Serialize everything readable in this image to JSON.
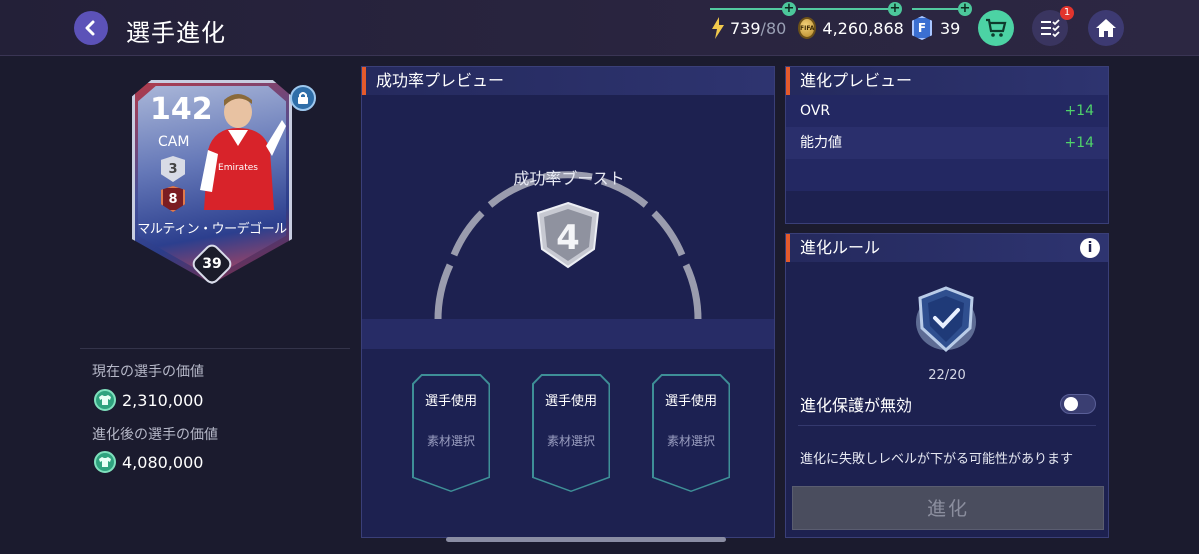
{
  "header": {
    "title": "選手進化",
    "energy": {
      "current": "739",
      "max": "/80"
    },
    "coins": "4,260,868",
    "fc_points": "39",
    "notification_count": "1"
  },
  "player_card": {
    "ovr": "142",
    "position": "CAM",
    "rank": "3",
    "level": "8",
    "name": "マルティン・ウーデゴール",
    "number": "39"
  },
  "values": {
    "current_label": "現在の選手の価値",
    "current_value": "2,310,000",
    "after_label": "進化後の選手の価値",
    "after_value": "4,080,000"
  },
  "success_panel": {
    "header": "成功率プレビュー",
    "boost_title": "成功率ブースト",
    "boost_level": "4",
    "slots": [
      {
        "title": "選手使用",
        "sub": "素材選択"
      },
      {
        "title": "選手使用",
        "sub": "素材選択"
      },
      {
        "title": "選手使用",
        "sub": "素材選択"
      }
    ]
  },
  "evolution_preview": {
    "header": "進化プレビュー",
    "rows": [
      {
        "label": "OVR",
        "value": "+14"
      },
      {
        "label": "能力値",
        "value": "+14"
      }
    ]
  },
  "evolution_rules": {
    "header": "進化ルール",
    "protect_count": "22/20",
    "protect_label": "進化保護が無効",
    "protect_enabled": false,
    "note": "進化に失敗しレベルが下がる可能性があります",
    "evolve_button": "進化"
  },
  "colors": {
    "accent_orange": "#e45a2c",
    "positive_green": "#4fd36a",
    "panel_bg": "#1d2150"
  }
}
